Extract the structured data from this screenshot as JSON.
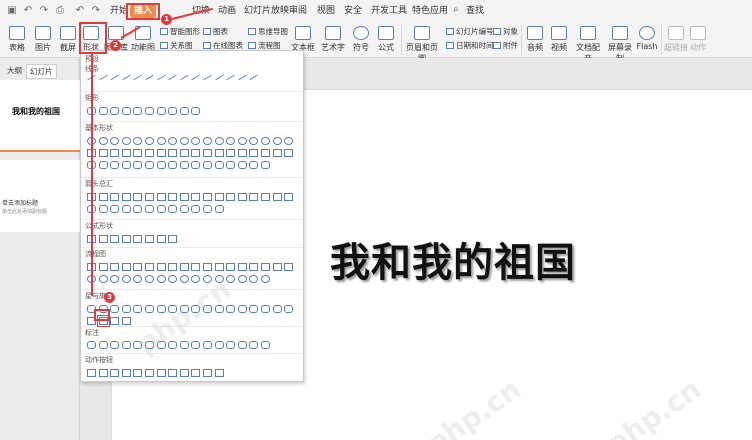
{
  "menubar": {
    "items": [
      "开始",
      "插入",
      "切换",
      "动画",
      "幻灯片放映",
      "审阅",
      "视图",
      "安全",
      "开发工具",
      "特色应用"
    ],
    "active": "插入",
    "search_label": "查找"
  },
  "ribbon": {
    "buttons": [
      "表格",
      "图片",
      "截屏",
      "形状",
      "图标库",
      "功能图",
      "智能图形",
      "关系图",
      "图表",
      "在线图表",
      "思维导图",
      "流程图",
      "文本框",
      "艺术字",
      "符号",
      "公式",
      "页眉和页脚",
      "幻灯片编号",
      "日期和时间",
      "对象",
      "附件",
      "音频",
      "视频",
      "文档配音",
      "屏幕录制",
      "Flash",
      "超链接",
      "动作"
    ]
  },
  "leftpanel": {
    "tabs": [
      "大纲",
      "幻灯片"
    ],
    "thumb1_title": "我和我的祖国",
    "thumb2_title": "单击添加标题",
    "thumb2_sub": "单击此处添加副标题"
  },
  "slide": {
    "title": "我和我的祖国"
  },
  "dropdown": {
    "sections": [
      "预设",
      "线条",
      "矩形",
      "基本形状",
      "箭头总汇",
      "公式形状",
      "流程图",
      "星与旗帜",
      "标注",
      "动作按钮"
    ]
  },
  "callouts": [
    "1",
    "2",
    "3"
  ],
  "watermark": "php.cn",
  "colors": {
    "accent": "#f08a4b",
    "callout": "#e23a3a",
    "shape_stroke": "#5a7fb5"
  }
}
